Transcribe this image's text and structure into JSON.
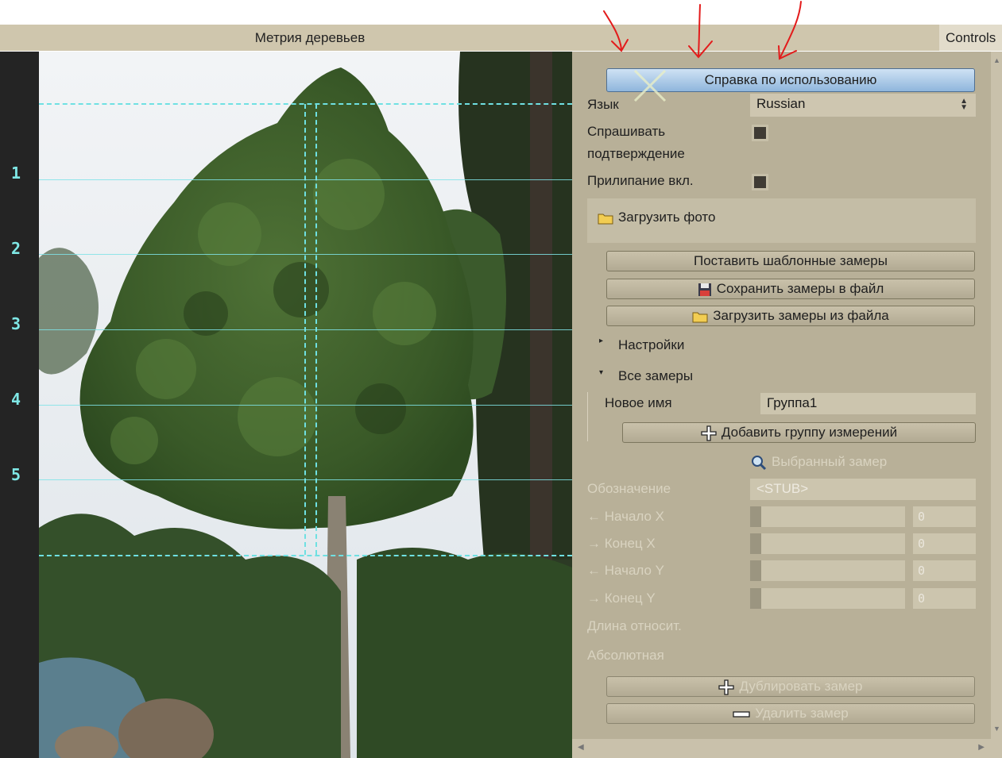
{
  "app": {
    "title": "Метрия деревьев",
    "controls_tab": "Controls"
  },
  "ruler": {
    "marks": [
      "1",
      "2",
      "3",
      "4",
      "5"
    ]
  },
  "controls": {
    "help_button": "Справка по использованию",
    "language_label": "Язык",
    "language_value": "Russian",
    "confirm_label_line1": "Спрашивать",
    "confirm_label_line2": "подтверждение",
    "snap_label": "Прилипание вкл.",
    "load_photo": "Загрузить фото",
    "set_template": "Поставить шаблонные замеры",
    "save_measurements": "Сохранить замеры в файл",
    "load_measurements": "Загрузить замеры из файла",
    "settings_folder": "Настройки",
    "all_measurements_folder": "Все замеры",
    "new_name_label": "Новое имя",
    "new_name_value": "Группа1",
    "add_group": "Добавить группу измерений",
    "selected_measurement": "Выбранный замер",
    "designation_label": "Обозначение",
    "designation_value": "<STUB>",
    "start_x_label": "← Начало X",
    "start_x_value": "0",
    "end_x_label": "→ Конец X",
    "end_x_value": "0",
    "start_y_label": "← Начало Y",
    "start_y_value": "0",
    "end_y_label": "→ Конец Y",
    "end_y_value": "0",
    "relative_length_label": "Длина относит.",
    "absolute_label": "Абсолютная",
    "duplicate_button": "Дублировать замер",
    "delete_button": "Удалить замер"
  },
  "colors": {
    "panel": "#b8b098",
    "guide_lines": "#7fe3e6",
    "annotation_arrows": "#e01b1b",
    "help_button": "#9fc0e2"
  }
}
